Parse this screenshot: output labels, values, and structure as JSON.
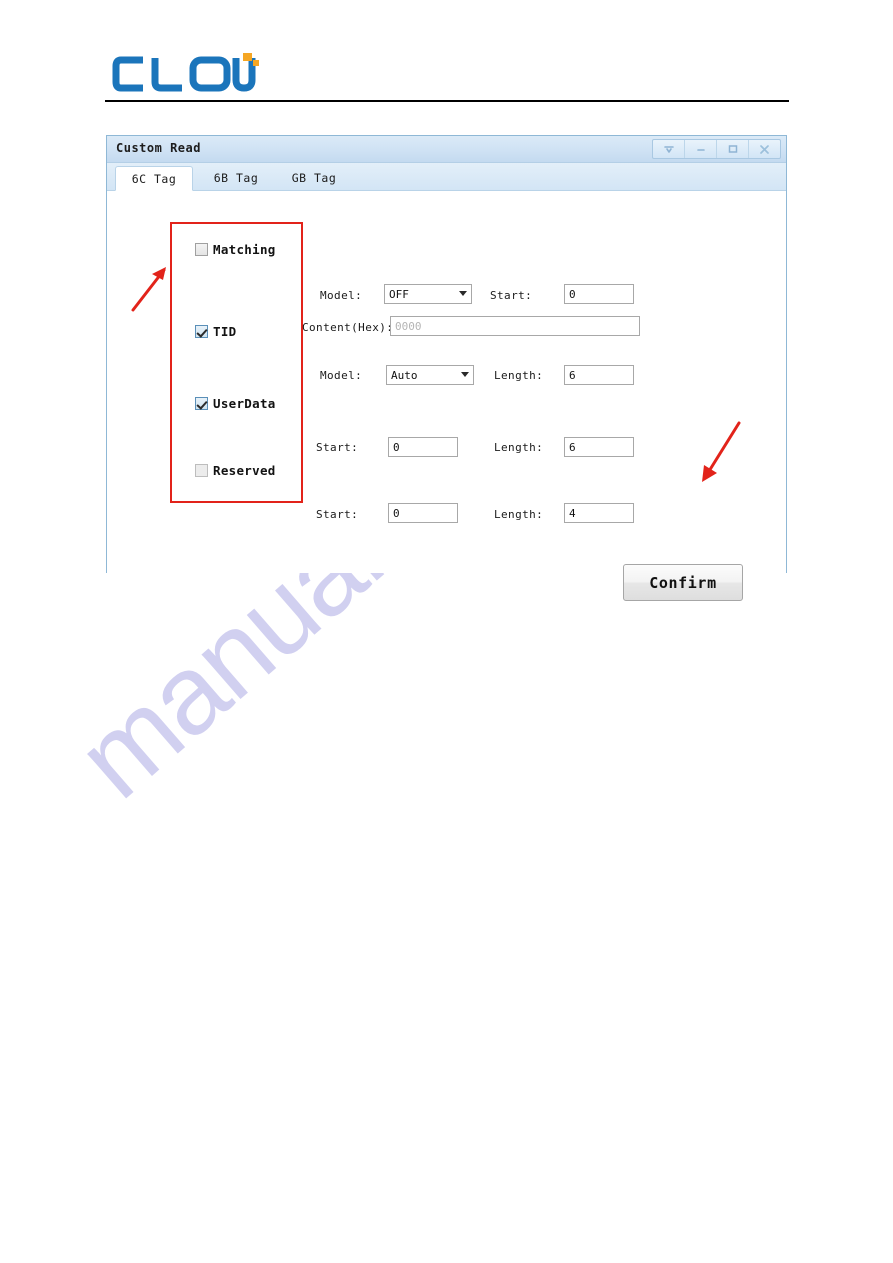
{
  "watermark": {
    "text": "manualshive.com"
  },
  "brand": {
    "name": "CLOU",
    "logo_color": "#1b75bb",
    "accent_color": "#f5a623"
  },
  "dialog": {
    "title": "Custom Read",
    "window_buttons": [
      {
        "name": "pin-icon",
        "label": "Pin"
      },
      {
        "name": "minimize-icon",
        "label": "Minimize"
      },
      {
        "name": "maximize-icon",
        "label": "Maximize"
      },
      {
        "name": "close-icon",
        "label": "Close"
      }
    ],
    "tabs": [
      {
        "label": "6C Tag",
        "active": true
      },
      {
        "label": "6B Tag",
        "active": false
      },
      {
        "label": "GB Tag",
        "active": false
      }
    ],
    "checkboxes": [
      {
        "label": "Matching",
        "checked": false,
        "disabled": false
      },
      {
        "label": "TID",
        "checked": true,
        "disabled": false
      },
      {
        "label": "UserData",
        "checked": true,
        "disabled": false
      },
      {
        "label": "Reserved",
        "checked": false,
        "disabled": true
      }
    ],
    "rows": {
      "matching": {
        "model_label": "Model:",
        "model_value": "OFF",
        "start_label": "Start:",
        "start_value": "0",
        "content_label": "Content(Hex):",
        "content_value": "",
        "content_placeholder": "0000"
      },
      "tid": {
        "model_label": "Model:",
        "model_value": "Auto",
        "length_label": "Length:",
        "length_value": "6"
      },
      "userdata": {
        "start_label": "Start:",
        "start_value": "0",
        "length_label": "Length:",
        "length_value": "6"
      },
      "reserved": {
        "start_label": "Start:",
        "start_value": "0",
        "length_label": "Length:",
        "length_value": "4"
      }
    },
    "confirm_label": "Confirm",
    "annotation_color": "#e2231a"
  }
}
